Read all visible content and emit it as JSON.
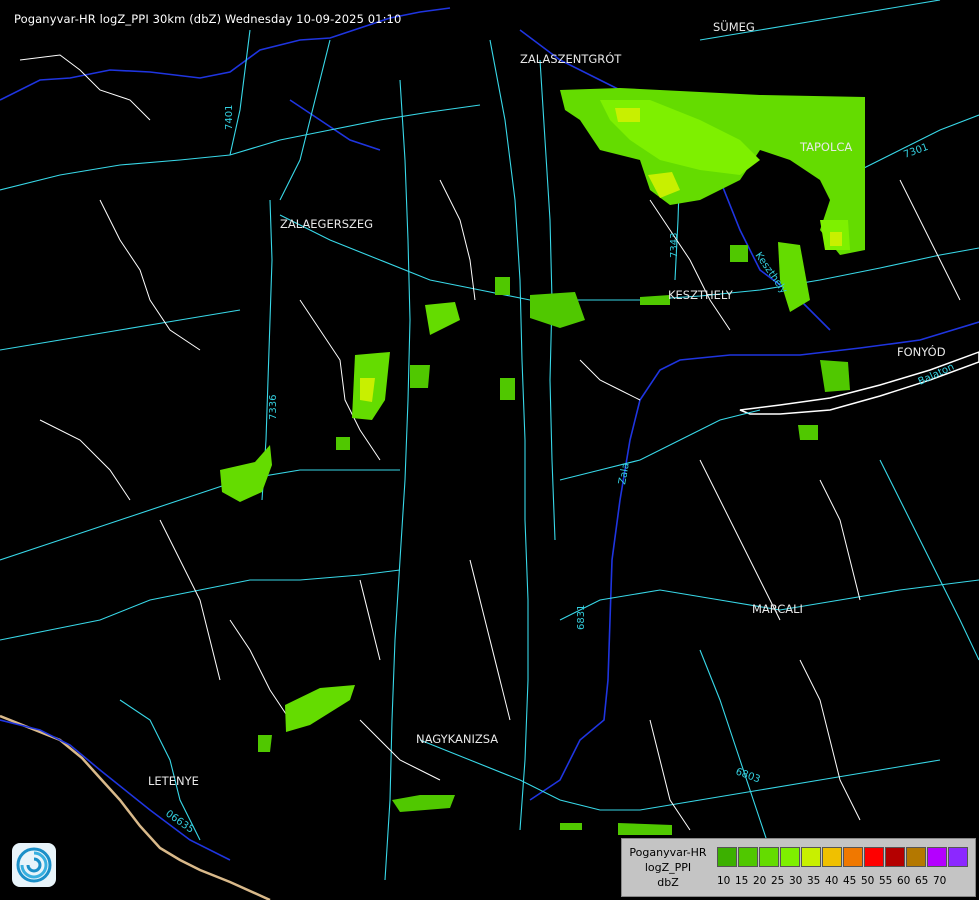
{
  "header": {
    "title": "Poganyvar-HR logZ_PPI 30km (dbZ) Wednesday 10-09-2025 01:10"
  },
  "cities": [
    {
      "name": "ZALASZENTGRÓT"
    },
    {
      "name": "SÜMEG"
    },
    {
      "name": "ZALAEGERSZEG"
    },
    {
      "name": "KESZTHELY"
    },
    {
      "name": "FONYÓD"
    },
    {
      "name": "MARCALI"
    },
    {
      "name": "NAGYKANIZSA"
    },
    {
      "name": "LETENYE"
    },
    {
      "name": "TAPOLCA"
    }
  ],
  "road_labels": [
    "7401",
    "7336",
    "7343",
    "7301",
    "6831",
    "6803",
    "06635",
    "Zala",
    "Keszthely",
    "Balaton"
  ],
  "legend": {
    "title_lines": [
      "Poganyvar-HR",
      "logZ_PPI",
      "dbZ"
    ],
    "ticks": [
      "10",
      "15",
      "20",
      "25",
      "30",
      "35",
      "40",
      "45",
      "50",
      "55",
      "60",
      "65",
      "70"
    ],
    "colors": [
      "#3cb000",
      "#50c800",
      "#64dc00",
      "#7ef000",
      "#c8f000",
      "#f0c000",
      "#f07800",
      "#ff0000",
      "#b40000",
      "#b47800",
      "#b400ff",
      "#8c28ff",
      "#b4b4ff"
    ]
  },
  "logo": {
    "icon": "omsz-logo-icon"
  }
}
